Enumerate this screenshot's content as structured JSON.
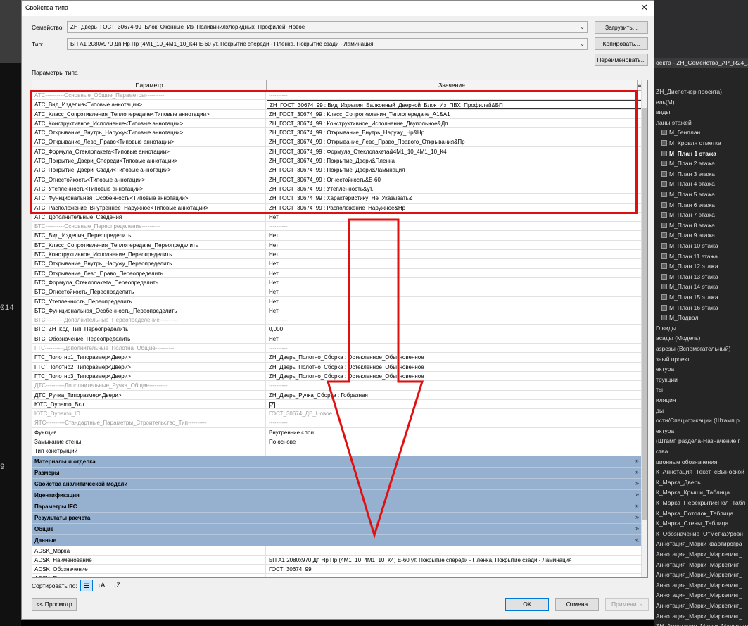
{
  "background_left": {
    "fragments": [
      "014",
      "9"
    ]
  },
  "project_browser": {
    "header": "оекта - ZH_Семейства_АР_R24_...",
    "items": [
      {
        "label": "ZH_Диспетчер проекта)",
        "bold": false,
        "icon": false
      },
      {
        "label": "ель(М)",
        "bold": false,
        "icon": false
      },
      {
        "label": "виды",
        "bold": false,
        "icon": false
      },
      {
        "label": "ланы этажей",
        "bold": false,
        "icon": false
      },
      {
        "label": "М_Генплан",
        "bold": false,
        "icon": true
      },
      {
        "label": "М_Кровля отметка",
        "bold": false,
        "icon": true
      },
      {
        "label": "М_План 1 этажа",
        "bold": true,
        "icon": true
      },
      {
        "label": "М_План 2 этажа",
        "bold": false,
        "icon": true
      },
      {
        "label": "М_План 3 этажа",
        "bold": false,
        "icon": true
      },
      {
        "label": "М_План 4 этажа",
        "bold": false,
        "icon": true
      },
      {
        "label": "М_План 5 этажа",
        "bold": false,
        "icon": true
      },
      {
        "label": "М_План 6 этажа",
        "bold": false,
        "icon": true
      },
      {
        "label": "М_План 7 этажа",
        "bold": false,
        "icon": true
      },
      {
        "label": "М_План 8 этажа",
        "bold": false,
        "icon": true
      },
      {
        "label": "М_План 9 этажа",
        "bold": false,
        "icon": true
      },
      {
        "label": "М_План 10 этажа",
        "bold": false,
        "icon": true
      },
      {
        "label": "М_План 11 этажа",
        "bold": false,
        "icon": true
      },
      {
        "label": "М_План 12 этажа",
        "bold": false,
        "icon": true
      },
      {
        "label": "М_План 13 этажа",
        "bold": false,
        "icon": true
      },
      {
        "label": "М_План 14 этажа",
        "bold": false,
        "icon": true
      },
      {
        "label": "М_План 15 этажа",
        "bold": false,
        "icon": true
      },
      {
        "label": "М_План 16 этажа",
        "bold": false,
        "icon": true
      },
      {
        "label": "М_Подвал",
        "bold": false,
        "icon": true
      },
      {
        "label": "D виды",
        "bold": false,
        "icon": false
      },
      {
        "label": "асады (Модель)",
        "bold": false,
        "icon": false
      },
      {
        "label": "азрезы (Вспомогательный)",
        "bold": false,
        "icon": false
      },
      {
        "label": "зный проект",
        "bold": false,
        "icon": false
      },
      {
        "label": "ектура",
        "bold": false,
        "icon": false
      },
      {
        "label": "трукции",
        "bold": false,
        "icon": false
      },
      {
        "label": "ты",
        "bold": false,
        "icon": false
      },
      {
        "label": "иляция",
        "bold": false,
        "icon": false
      },
      {
        "label": "ды",
        "bold": false,
        "icon": false
      },
      {
        "label": "ости/Спецификации (Штамп р",
        "bold": false,
        "icon": false
      },
      {
        "label": "ектура",
        "bold": false,
        "icon": false
      },
      {
        "label": "(Штамп раздела-Назначение г",
        "bold": false,
        "icon": false
      },
      {
        "label": "ства",
        "bold": false,
        "icon": false
      },
      {
        "label": "ционные обозначения",
        "bold": false,
        "icon": false
      },
      {
        "label": "К_Аннотация_Текст_сВыноской",
        "bold": false,
        "icon": false
      },
      {
        "label": "К_Марка_Дверь",
        "bold": false,
        "icon": false
      },
      {
        "label": "К_Марка_Крыши_Таблица",
        "bold": false,
        "icon": false
      },
      {
        "label": "К_Марка_ПерекрытиеПол_Табл",
        "bold": false,
        "icon": false
      },
      {
        "label": "К_Марка_Потолок_Таблица",
        "bold": false,
        "icon": false
      },
      {
        "label": "К_Марка_Стены_Таблица",
        "bold": false,
        "icon": false
      },
      {
        "label": "К_Обозначение_ОтметкаУровн",
        "bold": false,
        "icon": false
      },
      {
        "label": "Аннотация_Марки квартирогра",
        "bold": false,
        "icon": false
      },
      {
        "label": "Аннотация_Марки_Маркетинг_",
        "bold": false,
        "icon": false
      },
      {
        "label": "Аннотация_Марки_Маркетинг_",
        "bold": false,
        "icon": false
      },
      {
        "label": "Аннотация_Марки_Маркетинг_",
        "bold": false,
        "icon": false
      },
      {
        "label": "Аннотация_Марки_Маркетинг_",
        "bold": false,
        "icon": false
      },
      {
        "label": "Аннотация_Марки_Маркетинг_",
        "bold": false,
        "icon": false
      },
      {
        "label": "Аннотация_Марки_Маркетинг_",
        "bold": false,
        "icon": false
      },
      {
        "label": "Аннотация_Марки_Маркетинг_",
        "bold": false,
        "icon": false
      },
      {
        "label": "ZH_Аннотация_Марки_Маркетинг_",
        "bold": false,
        "icon": false
      }
    ]
  },
  "dialog": {
    "title": "Свойства типа",
    "family_label": "Семейство:",
    "family_value": "ZH_Дверь_ГОСТ_30674-99_Блок_Оконные_Из_Поливинилхлоридных_Профилей_Новое",
    "type_label": "Тип:",
    "type_value": "БП А1 2080х970 Дп Нр Пр (4М1_10_4М1_10_К4) Е-60 ут.  Покрытие спереди - Пленка, Покрытие сзади - Ламинация",
    "load_button": "Загрузить...",
    "copy_button": "Копировать...",
    "rename_button": "Переименовать...",
    "type_params_label": "Параметры типа",
    "col_param": "Параметр",
    "col_value": "Значение",
    "rows": [
      {
        "kind": "row",
        "param": "АТС----------Основные_Общие_Параметры----------",
        "value": "----------",
        "dim": true
      },
      {
        "kind": "row",
        "param": "АТС_Вид_Изделия<Типовые аннотации>",
        "value": "ZH_ГОСТ_30674_99 : Вид_Изделия_Балконный_Дверной_Блок_Из_ПВХ_Профилей&БП",
        "sel": true
      },
      {
        "kind": "row",
        "param": "АТС_Класс_Сопротивления_Теплопередаче<Типовые аннотации>",
        "value": "ZH_ГОСТ_30674_99 : Класс_Сопротивления_Теплопередаче_А1&А1"
      },
      {
        "kind": "row",
        "param": "АТС_Конструктивное_Исполнение<Типовые аннотации>",
        "value": "ZH_ГОСТ_30674_99 : Конструктивное_Исполнение_Двупольное&Дп"
      },
      {
        "kind": "row",
        "param": "АТС_Открывание_Внутрь_Наружу<Типовые аннотации>",
        "value": "ZH_ГОСТ_30674_99 : Открывание_Внутрь_Наружу_Нр&Нр"
      },
      {
        "kind": "row",
        "param": "АТС_Открывание_Лево_Право<Типовые аннотации>",
        "value": "ZH_ГОСТ_30674_99 : Открывание_Лево_Право_Правого_Открывания&Пр"
      },
      {
        "kind": "row",
        "param": "АТС_Формула_Стеклопакета<Типовые аннотации>",
        "value": "ZH_ГОСТ_30674_99 : Формула_Стеклопакета&4М1_10_4М1_10_К4"
      },
      {
        "kind": "row",
        "param": "АТС_Покрытие_Двери_Спереди<Типовые аннотации>",
        "value": "ZH_ГОСТ_30674_99 : Покрытие_Двери&Пленка"
      },
      {
        "kind": "row",
        "param": "АТС_Покрытие_Двери_Сзади<Типовые аннотации>",
        "value": "ZH_ГОСТ_30674_99 : Покрытие_Двери&Ламинация"
      },
      {
        "kind": "row",
        "param": "АТС_Огнестойкость<Типовые аннотации>",
        "value": "ZH_ГОСТ_30674_99 : Огнестойкость&Е-60"
      },
      {
        "kind": "row",
        "param": "АТС_Утепленность<Типовые аннотации>",
        "value": "ZH_ГОСТ_30674_99 : Утепленность&ут."
      },
      {
        "kind": "row",
        "param": "АТС_Функциональная_Особенность<Типовые аннотации>",
        "value": "ZH_ГОСТ_30674_99 : Характеристику_Не_Указывать&"
      },
      {
        "kind": "row",
        "param": "АТС_Расположение_Внутреннее_Наружное<Типовые аннотации>",
        "value": "ZH_ГОСТ_30674_99 : Расположение_Наружное&Нр"
      },
      {
        "kind": "row",
        "param": "АТС_Дополнительные_Сведения",
        "value": "Нет"
      },
      {
        "kind": "row",
        "param": "БТС----------Основные_Переопределение----------",
        "value": "----------",
        "dim": true
      },
      {
        "kind": "row",
        "param": "БТС_Вид_Изделия_Переопределить",
        "value": "Нет"
      },
      {
        "kind": "row",
        "param": "БТС_Класс_Сопротивления_Теплопередаче_Переопределить",
        "value": "Нет"
      },
      {
        "kind": "row",
        "param": "БТС_Конструктивное_Исполнение_Переопределить",
        "value": "Нет"
      },
      {
        "kind": "row",
        "param": "БТС_Открывание_Внутрь_Наружу_Переопределить",
        "value": "Нет"
      },
      {
        "kind": "row",
        "param": "БТС_Открывание_Лево_Право_Переопределить",
        "value": "Нет"
      },
      {
        "kind": "row",
        "param": "БТС_Формула_Стеклопакета_Переопределить",
        "value": "Нет"
      },
      {
        "kind": "row",
        "param": "БТС_Огнестойкость_Переопределить",
        "value": "Нет"
      },
      {
        "kind": "row",
        "param": "БТС_Утепленность_Переопределить",
        "value": "Нет"
      },
      {
        "kind": "row",
        "param": "БТС_Функциональная_Особенность_Переопределить",
        "value": "Нет"
      },
      {
        "kind": "row",
        "param": "ВТС----------Дополнительные_Переопределение----------",
        "value": "----------",
        "dim": true
      },
      {
        "kind": "row",
        "param": "ВТС_ZH_Код_Тип_Переопределить",
        "value": "0,000"
      },
      {
        "kind": "row",
        "param": "ВТС_Обозначение_Переопределить",
        "value": "Нет"
      },
      {
        "kind": "row",
        "param": "ГТС----------Дополнительные_Полотна_Общие----------",
        "value": "----------",
        "dim": true
      },
      {
        "kind": "row",
        "param": "ГТС_Полотно1_Типоразмер<Двери>",
        "value": "ZH_Дверь_Полотно_Сборка : Остекленное_Обыкновенное"
      },
      {
        "kind": "row",
        "param": "ГТС_Полотно2_Типоразмер<Двери>",
        "value": "ZH_Дверь_Полотно_Сборка : Остекленное_Обыкновенное"
      },
      {
        "kind": "row",
        "param": "ГТС_Полотно3_Типоразмер<Двери>",
        "value": "ZH_Дверь_Полотно_Сборка : Остекленное_Обыкновенное"
      },
      {
        "kind": "row",
        "param": "ДТС----------Дополнительные_Ручка_Общие----------",
        "value": "----------",
        "dim": true
      },
      {
        "kind": "row",
        "param": "ДТС_Ручка_Типоразмер<Двери>",
        "value": "ZH_Дверь_Ручка_Сборка : Гобразная"
      },
      {
        "kind": "check",
        "param": "ЮТС_Dynamo_Вкл",
        "value": "✓"
      },
      {
        "kind": "row",
        "param": "ЮТС_Dynamo_ID",
        "value": "ГОСТ_30674_ДБ_Новое",
        "dim": true
      },
      {
        "kind": "row",
        "param": "ЯТС----------Стандартные_Параметры_Строительство_Тип----------",
        "value": "----------",
        "dim": true
      },
      {
        "kind": "row",
        "param": "Функция",
        "value": "Внутренние слои"
      },
      {
        "kind": "row",
        "param": "Замыкание стены",
        "value": "По основе"
      },
      {
        "kind": "row",
        "param": "Тип конструкций",
        "value": ""
      },
      {
        "kind": "group",
        "param": "Материалы и отделка",
        "chev": "»"
      },
      {
        "kind": "group",
        "param": "Размеры",
        "chev": "»"
      },
      {
        "kind": "group",
        "param": "Свойства аналитической модели",
        "chev": "»"
      },
      {
        "kind": "group",
        "param": "Идентификация",
        "chev": "»"
      },
      {
        "kind": "group",
        "param": "Параметры IFC",
        "chev": "»"
      },
      {
        "kind": "group",
        "param": "Результаты расчета",
        "chev": "»"
      },
      {
        "kind": "group",
        "param": "Общие",
        "chev": "»"
      },
      {
        "kind": "group",
        "param": "Данные",
        "chev": "«"
      },
      {
        "kind": "row",
        "param": "ADSK_Марка",
        "value": ""
      },
      {
        "kind": "row",
        "param": "ADSK_Наименование",
        "value": "БП А1 2080х970 Дп Нр Пр (4М1_10_4М1_10_К4) Е-60 ут.  Покрытие спереди - Пленка, Покрытие сзади - Ламинация"
      },
      {
        "kind": "row",
        "param": "ADSK_Обозначение",
        "value": "ГОСТ_30674_99"
      },
      {
        "kind": "row",
        "param": "ADSK_Примечание",
        "value": ""
      }
    ],
    "sort_label": "Сортировать по:",
    "preview_button": "<< Просмотр",
    "ok_button": "ОК",
    "cancel_button": "Отмена",
    "apply_button": "Применить"
  },
  "colors": {
    "highlight": "#e01010",
    "group_row": "#96b0d0"
  }
}
